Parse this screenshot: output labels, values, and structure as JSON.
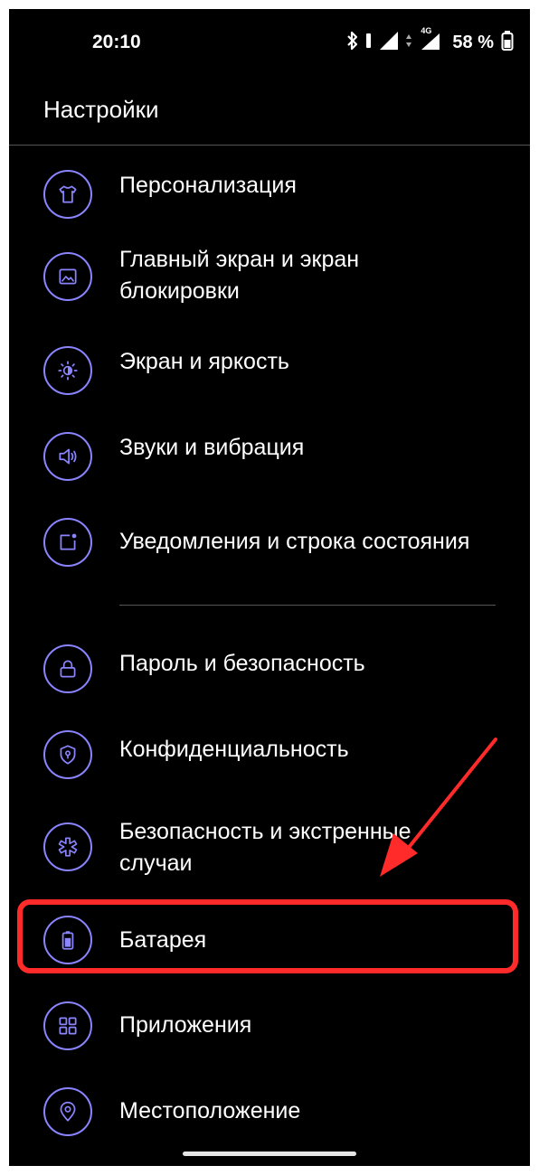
{
  "status_bar": {
    "time": "20:10",
    "network": "4G",
    "battery_percent": "58 %"
  },
  "header": {
    "title": "Настройки"
  },
  "colors": {
    "icon_accent": "#8a84ff",
    "highlight": "#ff2a2a",
    "background": "#000000"
  },
  "settings": {
    "items": [
      {
        "label": "Персонализация",
        "icon": "tshirt-icon"
      },
      {
        "label_line1": "Главный экран и экран",
        "label_line2": "блокировки",
        "icon": "picture-icon"
      },
      {
        "label": "Экран и яркость",
        "icon": "brightness-icon"
      },
      {
        "label": "Звуки и вибрация",
        "icon": "speaker-icon"
      },
      {
        "label": "Уведомления и строка состояния",
        "icon": "notification-icon"
      },
      {
        "label": "Пароль и безопасность",
        "icon": "lock-icon"
      },
      {
        "label": "Конфиденциальность",
        "icon": "shield-icon"
      },
      {
        "label_line1": "Безопасность и экстренные",
        "label_line2": "случаи",
        "icon": "emergency-icon"
      },
      {
        "label": "Батарея",
        "icon": "battery-icon",
        "highlighted": true
      },
      {
        "label": "Приложения",
        "icon": "apps-grid-icon"
      },
      {
        "label": "Местоположение",
        "icon": "location-pin-icon"
      }
    ]
  }
}
